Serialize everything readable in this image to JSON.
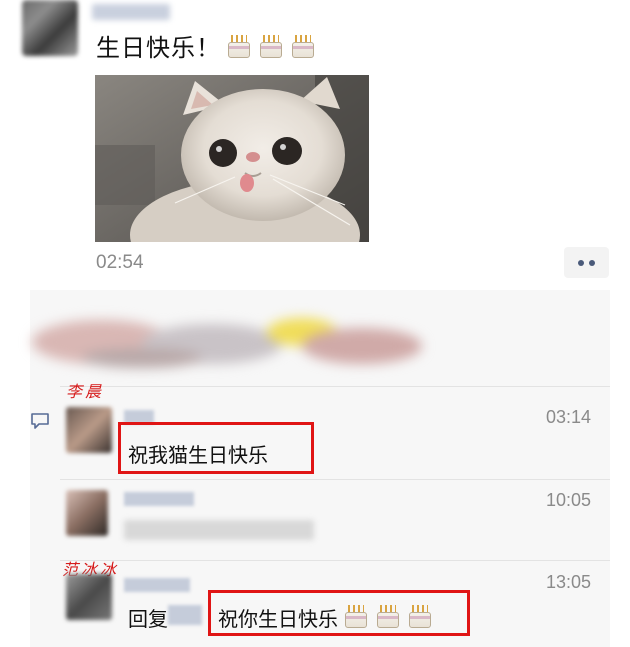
{
  "post": {
    "text": "生日快乐！",
    "emoji": [
      "cake-icon",
      "cake-icon",
      "cake-icon"
    ],
    "time": "02:54"
  },
  "comments": [
    {
      "annotation": "李晨",
      "time": "03:14",
      "text": "祝我猫生日快乐"
    },
    {
      "annotation": "",
      "time": "10:05",
      "text": ""
    },
    {
      "annotation": "范冰冰",
      "time": "13:05",
      "reply_prefix": "回复",
      "text": "祝你生日快乐"
    }
  ],
  "colors": {
    "highlight": "#e01515",
    "annotation": "#d61b1b",
    "link": "#576b95"
  }
}
